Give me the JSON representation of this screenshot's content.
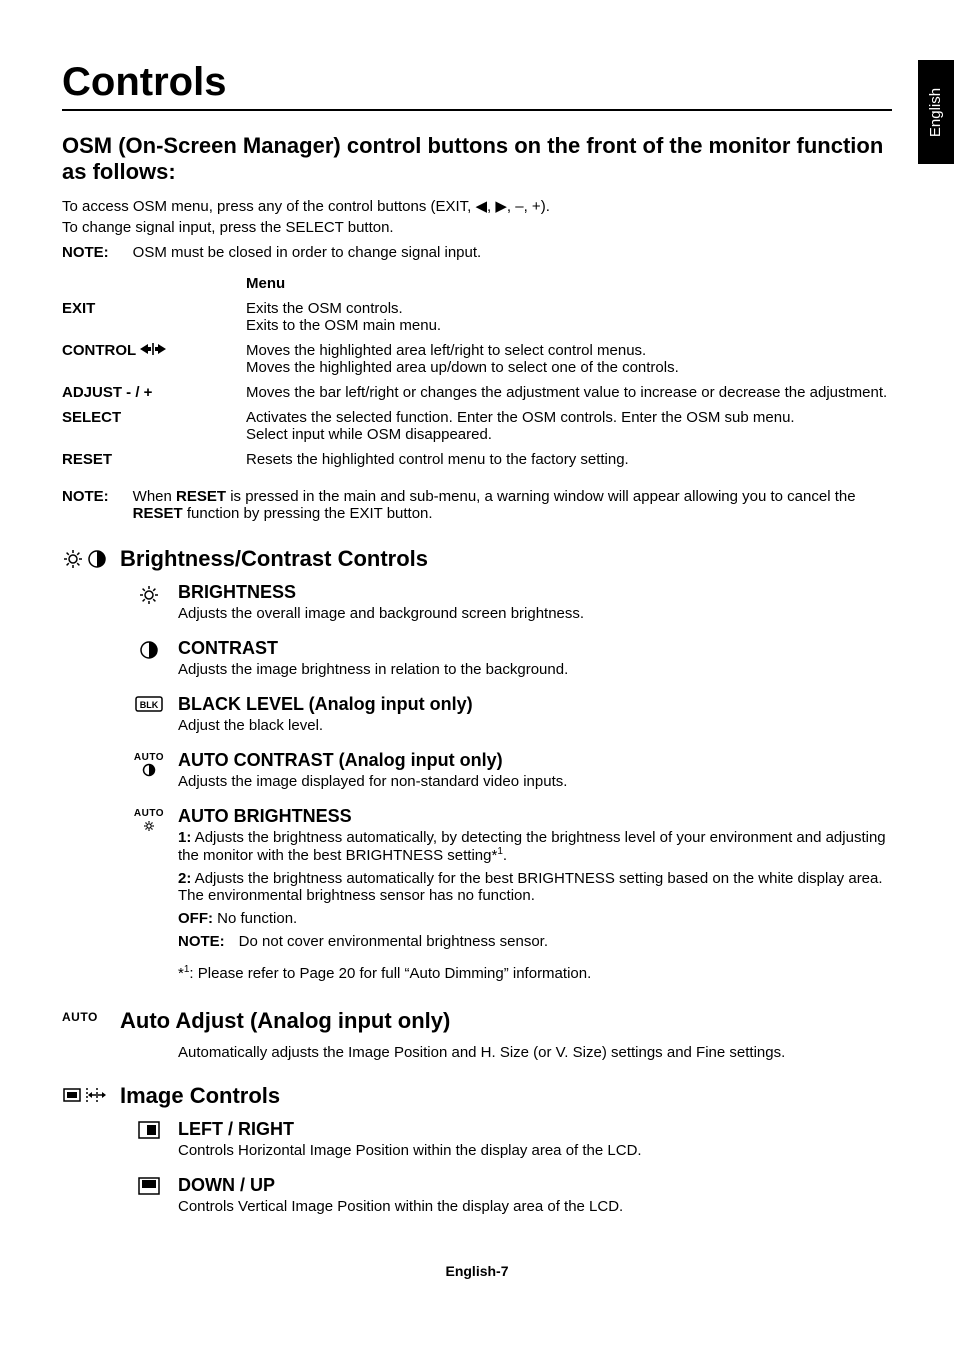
{
  "sideTab": "English",
  "title": "Controls",
  "subtitle": "OSM (On-Screen Manager) control buttons on the front of the monitor function as follows:",
  "intro1": "To access OSM menu, press any of the control buttons (EXIT, ◀, ▶, –, +).",
  "intro2": "To change signal input, press the SELECT button.",
  "note1Label": "NOTE:",
  "note1Text": "OSM must be closed in order to change signal input.",
  "menuHeading": "Menu",
  "controls": {
    "exit": {
      "label": "EXIT",
      "line1": "Exits the OSM controls.",
      "line2": "Exits to the OSM main menu."
    },
    "control": {
      "label": "CONTROL ",
      "line1": "Moves the highlighted area left/right to select control menus.",
      "line2": "Moves the highlighted area up/down to select one of the controls."
    },
    "adjust": {
      "label": "ADJUST - / +",
      "line1": "Moves the bar left/right or changes the adjustment value to increase or decrease the adjustment."
    },
    "select": {
      "label": "SELECT",
      "line1": "Activates the selected function. Enter the OSM controls. Enter the OSM sub menu.",
      "line2": "Select input while OSM disappeared."
    },
    "reset": {
      "label": "RESET",
      "line1": "Resets the highlighted control menu to the factory setting."
    }
  },
  "resetNoteLabel": "NOTE:",
  "resetNote1": "When ",
  "resetNoteBold1": "RESET",
  "resetNote2": " is pressed in the main and sub-menu, a warning window will appear allowing you to cancel the ",
  "resetNoteBold2": "RESET",
  "resetNote3": " function by pressing the EXIT button.",
  "sections": {
    "bc": {
      "title": "Brightness/Contrast Controls",
      "brightness": {
        "title": "BRIGHTNESS",
        "desc": "Adjusts the overall image and background screen brightness."
      },
      "contrast": {
        "title": "CONTRAST",
        "desc": "Adjusts the image brightness in relation to the background."
      },
      "black": {
        "title": "BLACK LEVEL (Analog input only)",
        "desc": "Adjust the black level."
      },
      "autocontrast": {
        "title": "AUTO CONTRAST (Analog input only)",
        "desc": "Adjusts the image displayed for non-standard video inputs."
      },
      "autobright": {
        "title": "AUTO BRIGHTNESS",
        "line1b": "1:",
        "line1": " Adjusts the brightness automatically, by detecting the brightness level of your environment and adjusting the monitor with the best BRIGHTNESS setting*",
        "line1sup": "1",
        "line1end": ".",
        "line2b": "2:",
        "line2": " Adjusts the brightness automatically for the best BRIGHTNESS setting based on the white display area. The environmental brightness sensor has no function.",
        "line3b": "OFF:",
        "line3": " No function.",
        "subnoteLabel": "NOTE:",
        "subnote": "Do not cover environmental brightness sensor.",
        "footnote": "*1: Please refer to Page 20 for full “Auto Dimming” information."
      }
    },
    "auto": {
      "label": "AUTO",
      "title": "Auto Adjust (Analog input only)",
      "desc": "Automatically adjusts the Image Position and H. Size (or V. Size) settings and Fine settings."
    },
    "img": {
      "title": "Image Controls",
      "lr": {
        "title": "LEFT / RIGHT",
        "desc": "Controls Horizontal Image Position within the display area of the LCD."
      },
      "du": {
        "title": "DOWN / UP",
        "desc": "Controls Vertical Image Position within the display area of the LCD."
      }
    }
  },
  "pageNumber": "English-7"
}
